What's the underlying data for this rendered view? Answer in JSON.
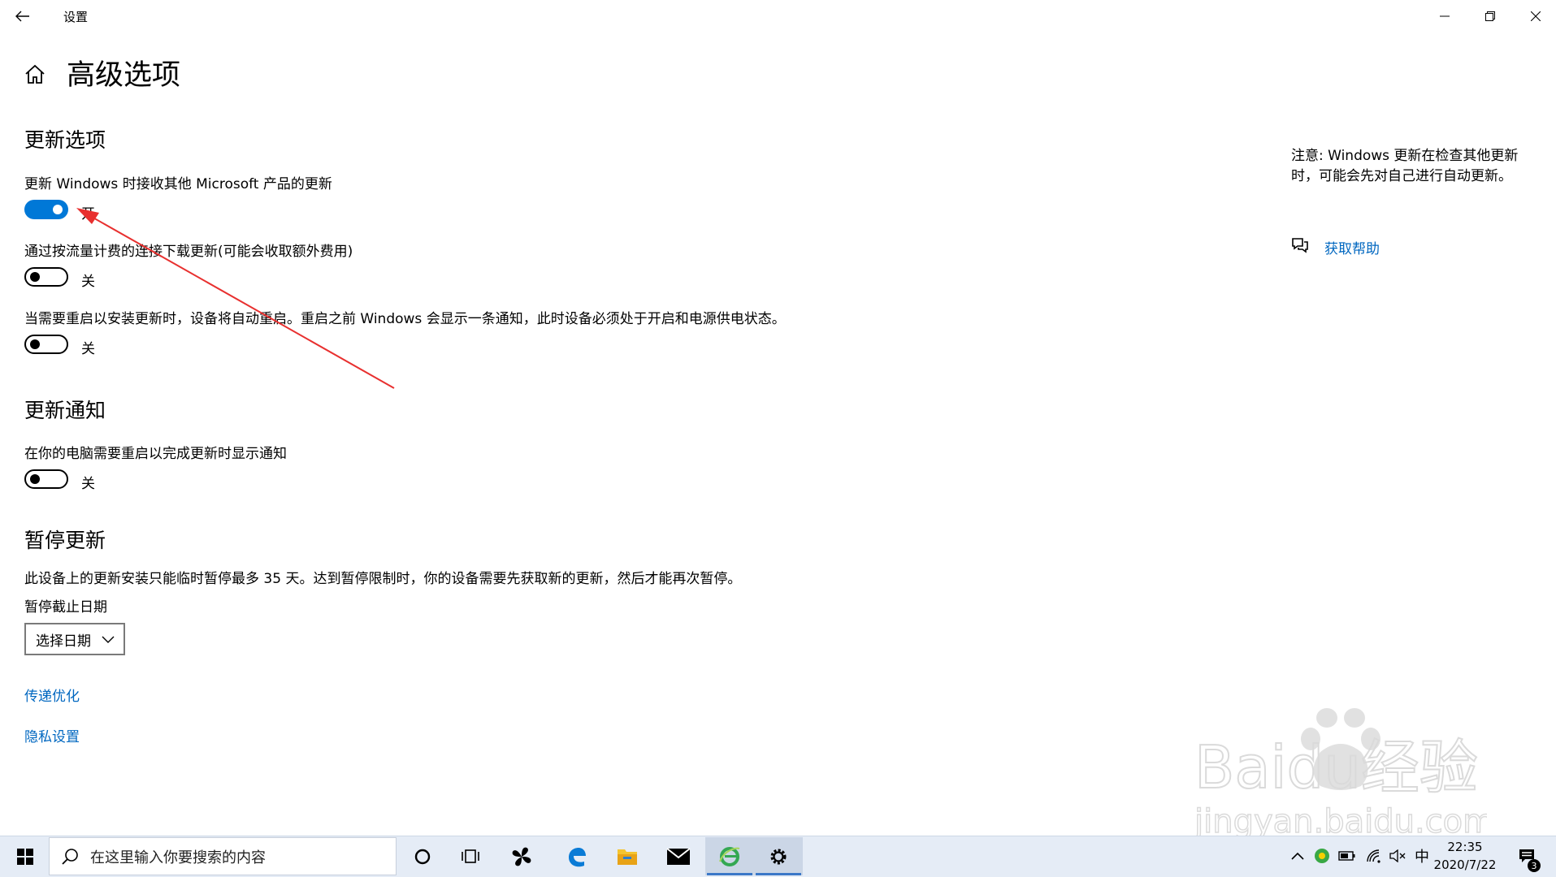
{
  "window": {
    "title": "设置",
    "back_icon": "back-arrow-icon",
    "minimize_icon": "minimize-icon",
    "maximize_icon": "restore-icon",
    "close_icon": "close-icon"
  },
  "page": {
    "home_icon": "home-icon",
    "title": "高级选项"
  },
  "sections": {
    "update_options": {
      "title": "更新选项",
      "items": [
        {
          "label": "更新 Windows 时接收其他 Microsoft 产品的更新",
          "state": "开",
          "on": true
        },
        {
          "label": "通过按流量计费的连接下载更新(可能会收取额外费用)",
          "state": "关",
          "on": false
        },
        {
          "label": "当需要重启以安装更新时，设备将自动重启。重启之前 Windows 会显示一条通知，此时设备必须处于开启和电源供电状态。",
          "state": "关",
          "on": false
        }
      ]
    },
    "update_notifications": {
      "title": "更新通知",
      "items": [
        {
          "label": "在你的电脑需要重启以完成更新时显示通知",
          "state": "关",
          "on": false
        }
      ]
    },
    "pause_updates": {
      "title": "暂停更新",
      "description": "此设备上的更新安装只能临时暂停最多 35 天。达到暂停限制时，你的设备需要先获取新的更新，然后才能再次暂停。",
      "date_label": "暂停截止日期",
      "date_select": "选择日期"
    }
  },
  "links": {
    "delivery_optimization": "传递优化",
    "privacy_settings": "隐私设置"
  },
  "side_panel": {
    "note": "注意: Windows 更新在检查其他更新时，可能会先对自己进行自动更新。",
    "help_icon": "chat-help-icon",
    "help_link": "获取帮助"
  },
  "watermark": {
    "brand": "Baidu经验",
    "url": "jingyan.baidu.com"
  },
  "taskbar": {
    "search_placeholder": "在这里输入你要搜索的内容",
    "icons": [
      "windows-start-icon",
      "cortana-icon",
      "task-view-icon",
      "pinwheel-app-icon",
      "edge-icon",
      "file-explorer-icon",
      "mail-icon",
      "ie-browser-icon",
      "settings-icon"
    ],
    "tray": {
      "ime": "中",
      "time": "22:35",
      "date": "2020/7/22",
      "notifications": "3"
    }
  },
  "colors": {
    "accent": "#0078d7",
    "link": "#0067c0",
    "taskbar": "#e5ecf6",
    "annotation_arrow": "#e8302f"
  }
}
